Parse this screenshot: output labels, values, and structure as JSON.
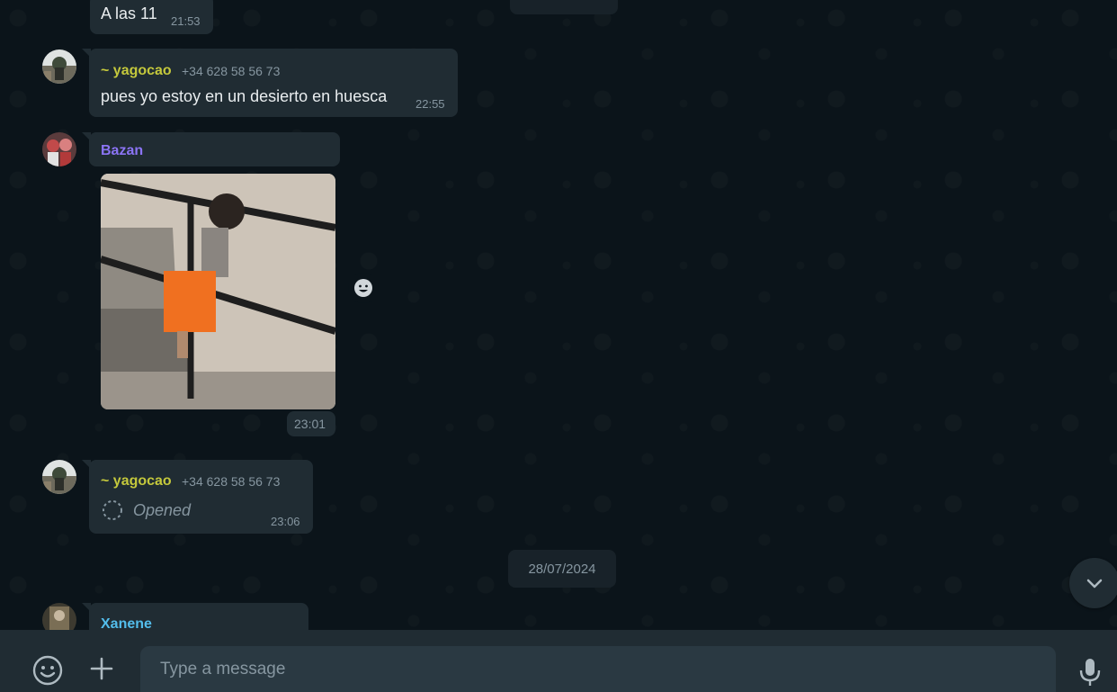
{
  "messages": {
    "first": {
      "text": "A las 11",
      "time": "21:53"
    },
    "yago1": {
      "sender": "~ yagocao",
      "phone": "+34 628 58 56 73",
      "text": "pues yo estoy en un desierto en huesca",
      "time": "22:55"
    },
    "bazan": {
      "sender": "Bazan",
      "time": "23:01"
    },
    "yago2": {
      "sender": "~ yagocao",
      "phone": "+34 628 58 56 73",
      "status": "Opened",
      "time": "23:06"
    },
    "xanene": {
      "sender": "Xanene"
    }
  },
  "date_divider": "28/07/2024",
  "composer": {
    "placeholder": "Type a message"
  },
  "colors": {
    "yagocao_name": "#c4c83c",
    "bazan_name": "#8b74f5",
    "xanene_name": "#53bdeb",
    "bubble": "#202c33",
    "background": "#0b141a"
  },
  "icons": [
    "emoji-icon",
    "plus-icon",
    "microphone-icon",
    "chevron-down-icon",
    "react-emoji-icon",
    "loading-ring-icon"
  ]
}
